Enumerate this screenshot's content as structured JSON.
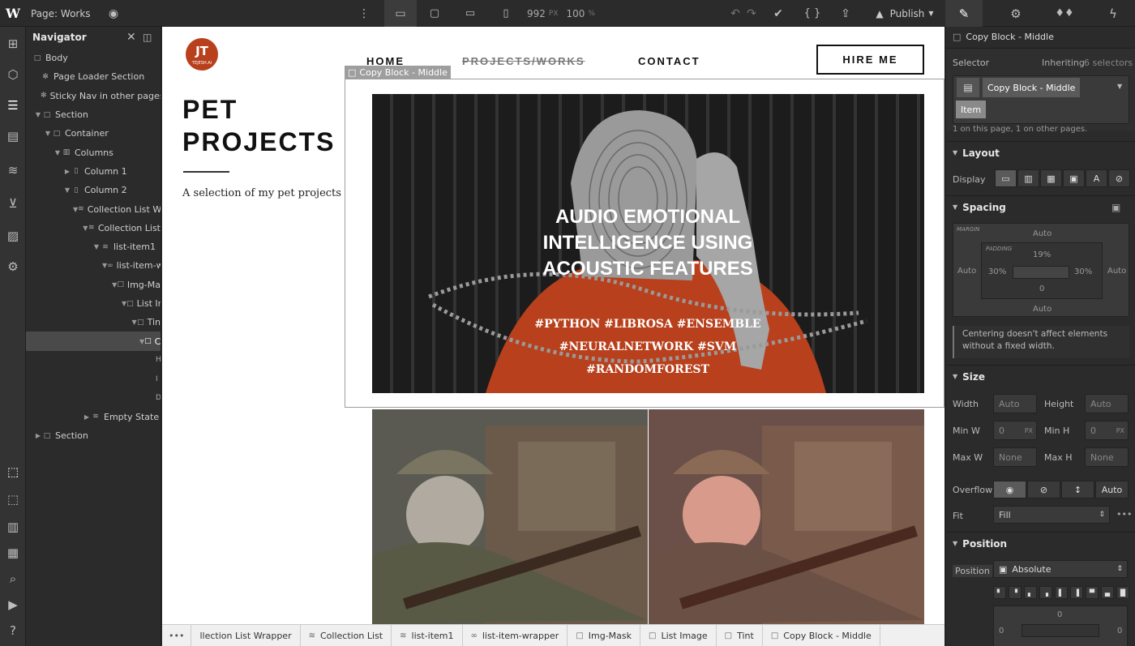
{
  "topbar": {
    "page_label": "Page: Works",
    "width_value": "992",
    "width_unit": "PX",
    "zoom_value": "100",
    "zoom_unit": "%",
    "publish_label": "Publish"
  },
  "navigator": {
    "title": "Navigator",
    "items": [
      {
        "label": "Body"
      },
      {
        "label": "Page Loader Section"
      },
      {
        "label": "Sticky Nav in other pages"
      },
      {
        "label": "Section"
      },
      {
        "label": "Container"
      },
      {
        "label": "Columns"
      },
      {
        "label": "Column 1"
      },
      {
        "label": "Column 2"
      },
      {
        "label": "Collection List W"
      },
      {
        "label": "Collection List"
      },
      {
        "label": "list-item1"
      },
      {
        "label": "list-item-w"
      },
      {
        "label": "Img-Ma"
      },
      {
        "label": "List Ir"
      },
      {
        "label": "Tin"
      },
      {
        "label": "C"
      },
      {
        "label": "H"
      },
      {
        "label": "I"
      },
      {
        "label": "D"
      },
      {
        "label": "Empty State"
      },
      {
        "label": "Section"
      }
    ]
  },
  "site": {
    "logo_text": "JT",
    "logo_sub": "TEJESH.AI",
    "nav": [
      "HOME",
      "PROJECTS/WORKS",
      "CONTACT"
    ],
    "hire_label": "HIRE ME",
    "heading_line1": "PET",
    "heading_line2": "PROJECTS",
    "subtitle": "A selection of my pet projects",
    "selection_tag": "Copy Block - Middle",
    "card_title": "AUDIO EMOTIONAL INTELLIGENCE USING ACOUSTIC FEATURES",
    "card_tags": [
      "#PYTHON #LIBROSA #ENSEMBLE",
      "#NEURALNETWORK #SVM",
      "#RANDOMFOREST"
    ]
  },
  "breadcrumb": [
    "llection List Wrapper",
    "Collection List",
    "list-item1",
    "list-item-wrapper",
    "Img-Mask",
    "List Image",
    "Tint",
    "Copy Block - Middle"
  ],
  "panel": {
    "element_name": "Copy Block - Middle",
    "selector_label": "Selector",
    "inheriting_label": "Inheriting",
    "inheriting_count": "6 selectors",
    "selector_chip": "Copy Block - Middle",
    "item_chip": "Item",
    "usage_text": "1 on this page, 1 on other pages.",
    "layout_title": "Layout",
    "display_label": "Display",
    "spacing_title": "Spacing",
    "margin_label": "MARGIN",
    "padding_label": "PADDING",
    "margin_top": "Auto",
    "margin_left": "Auto",
    "margin_right": "Auto",
    "margin_bottom": "Auto",
    "padding_top": "19%",
    "padding_left": "30%",
    "padding_right": "30%",
    "padding_bottom": "0",
    "center_note": "Centering doesn't affect elements without a fixed width.",
    "size_title": "Size",
    "width_label": "Width",
    "width_val": "Auto",
    "height_label": "Height",
    "height_val": "Auto",
    "minw_label": "Min W",
    "minw_val": "0",
    "minw_unit": "PX",
    "minh_label": "Min H",
    "minh_val": "0",
    "minh_unit": "PX",
    "maxw_label": "Max W",
    "maxw_val": "None",
    "maxh_label": "Max H",
    "maxh_val": "None",
    "overflow_label": "Overflow",
    "overflow_auto": "Auto",
    "fit_label": "Fit",
    "fit_val": "Fill",
    "position_title": "Position",
    "position_label": "Position",
    "position_val": "Absolute",
    "pos_top": "0",
    "pos_left": "0",
    "pos_right": "0"
  },
  "colors": {
    "editor_bg": "#2b2b2b",
    "accent_blue": "#4a90d9",
    "selection_gray": "#9e9e9e",
    "card_red": "#b8401c"
  }
}
